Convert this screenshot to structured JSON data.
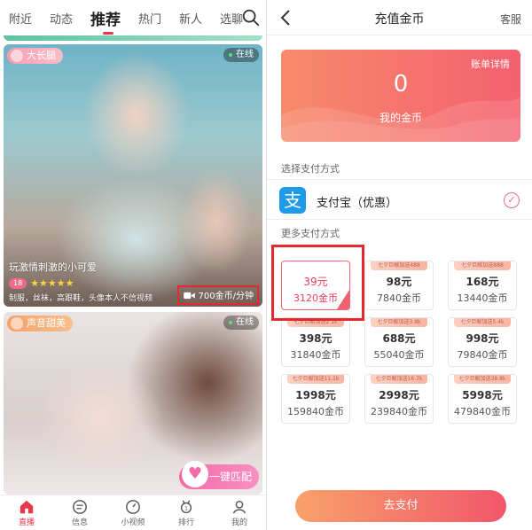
{
  "left": {
    "tabs": [
      "附近",
      "动态",
      "推荐",
      "热门",
      "新人",
      "选聊"
    ],
    "active_tab": "推荐",
    "card1": {
      "tag": "大长腿",
      "status": "在线",
      "title": "玩激情刺激的小可爱",
      "level": "18",
      "stars": "★★★★★",
      "description": "制服，丝袜，高跟鞋，头像本人不信视频",
      "price": "700金币/分钟"
    },
    "card2": {
      "tag": "声音甜美",
      "status": "在线",
      "match_button": "一键匹配"
    },
    "bottom_nav": [
      {
        "label": "直播",
        "icon": "home-icon"
      },
      {
        "label": "信息",
        "icon": "message-icon"
      },
      {
        "label": "小视频",
        "icon": "video-icon"
      },
      {
        "label": "排行",
        "icon": "ranking-icon"
      },
      {
        "label": "我的",
        "icon": "profile-icon"
      }
    ],
    "accent_color": "#e8394c"
  },
  "right": {
    "title": "充值金币",
    "service": "客服",
    "balance": {
      "bill_link": "账单详情",
      "amount": "0",
      "label": "我的金币"
    },
    "select_payment_label": "选择支付方式",
    "payment_method": "支付宝（优惠）",
    "more_payment_label": "更多支付方式",
    "packages": [
      {
        "promo": "",
        "price": "39元",
        "coins": "3120金币",
        "selected": true
      },
      {
        "promo": "七夕巨献加送488",
        "price": "98元",
        "coins": "7840金币",
        "selected": false
      },
      {
        "promo": "七夕巨献加送888",
        "price": "168元",
        "coins": "13440金币",
        "selected": false
      },
      {
        "promo": "七夕巨献加送2.1k",
        "price": "398元",
        "coins": "31840金币",
        "selected": false
      },
      {
        "promo": "七夕巨献加送3.8k",
        "price": "688元",
        "coins": "55040金币",
        "selected": false
      },
      {
        "promo": "七夕巨献加送5.4k",
        "price": "998元",
        "coins": "79840金币",
        "selected": false
      },
      {
        "promo": "七夕巨献加送11.1k",
        "price": "1998元",
        "coins": "159840金币",
        "selected": false
      },
      {
        "promo": "七夕巨献加送16.7k",
        "price": "2998元",
        "coins": "239840金币",
        "selected": false
      },
      {
        "promo": "七夕巨献加送38.8k",
        "price": "5998元",
        "coins": "479840金币",
        "selected": false
      }
    ],
    "pay_button": "去支付",
    "accent_color": "#f06272"
  }
}
